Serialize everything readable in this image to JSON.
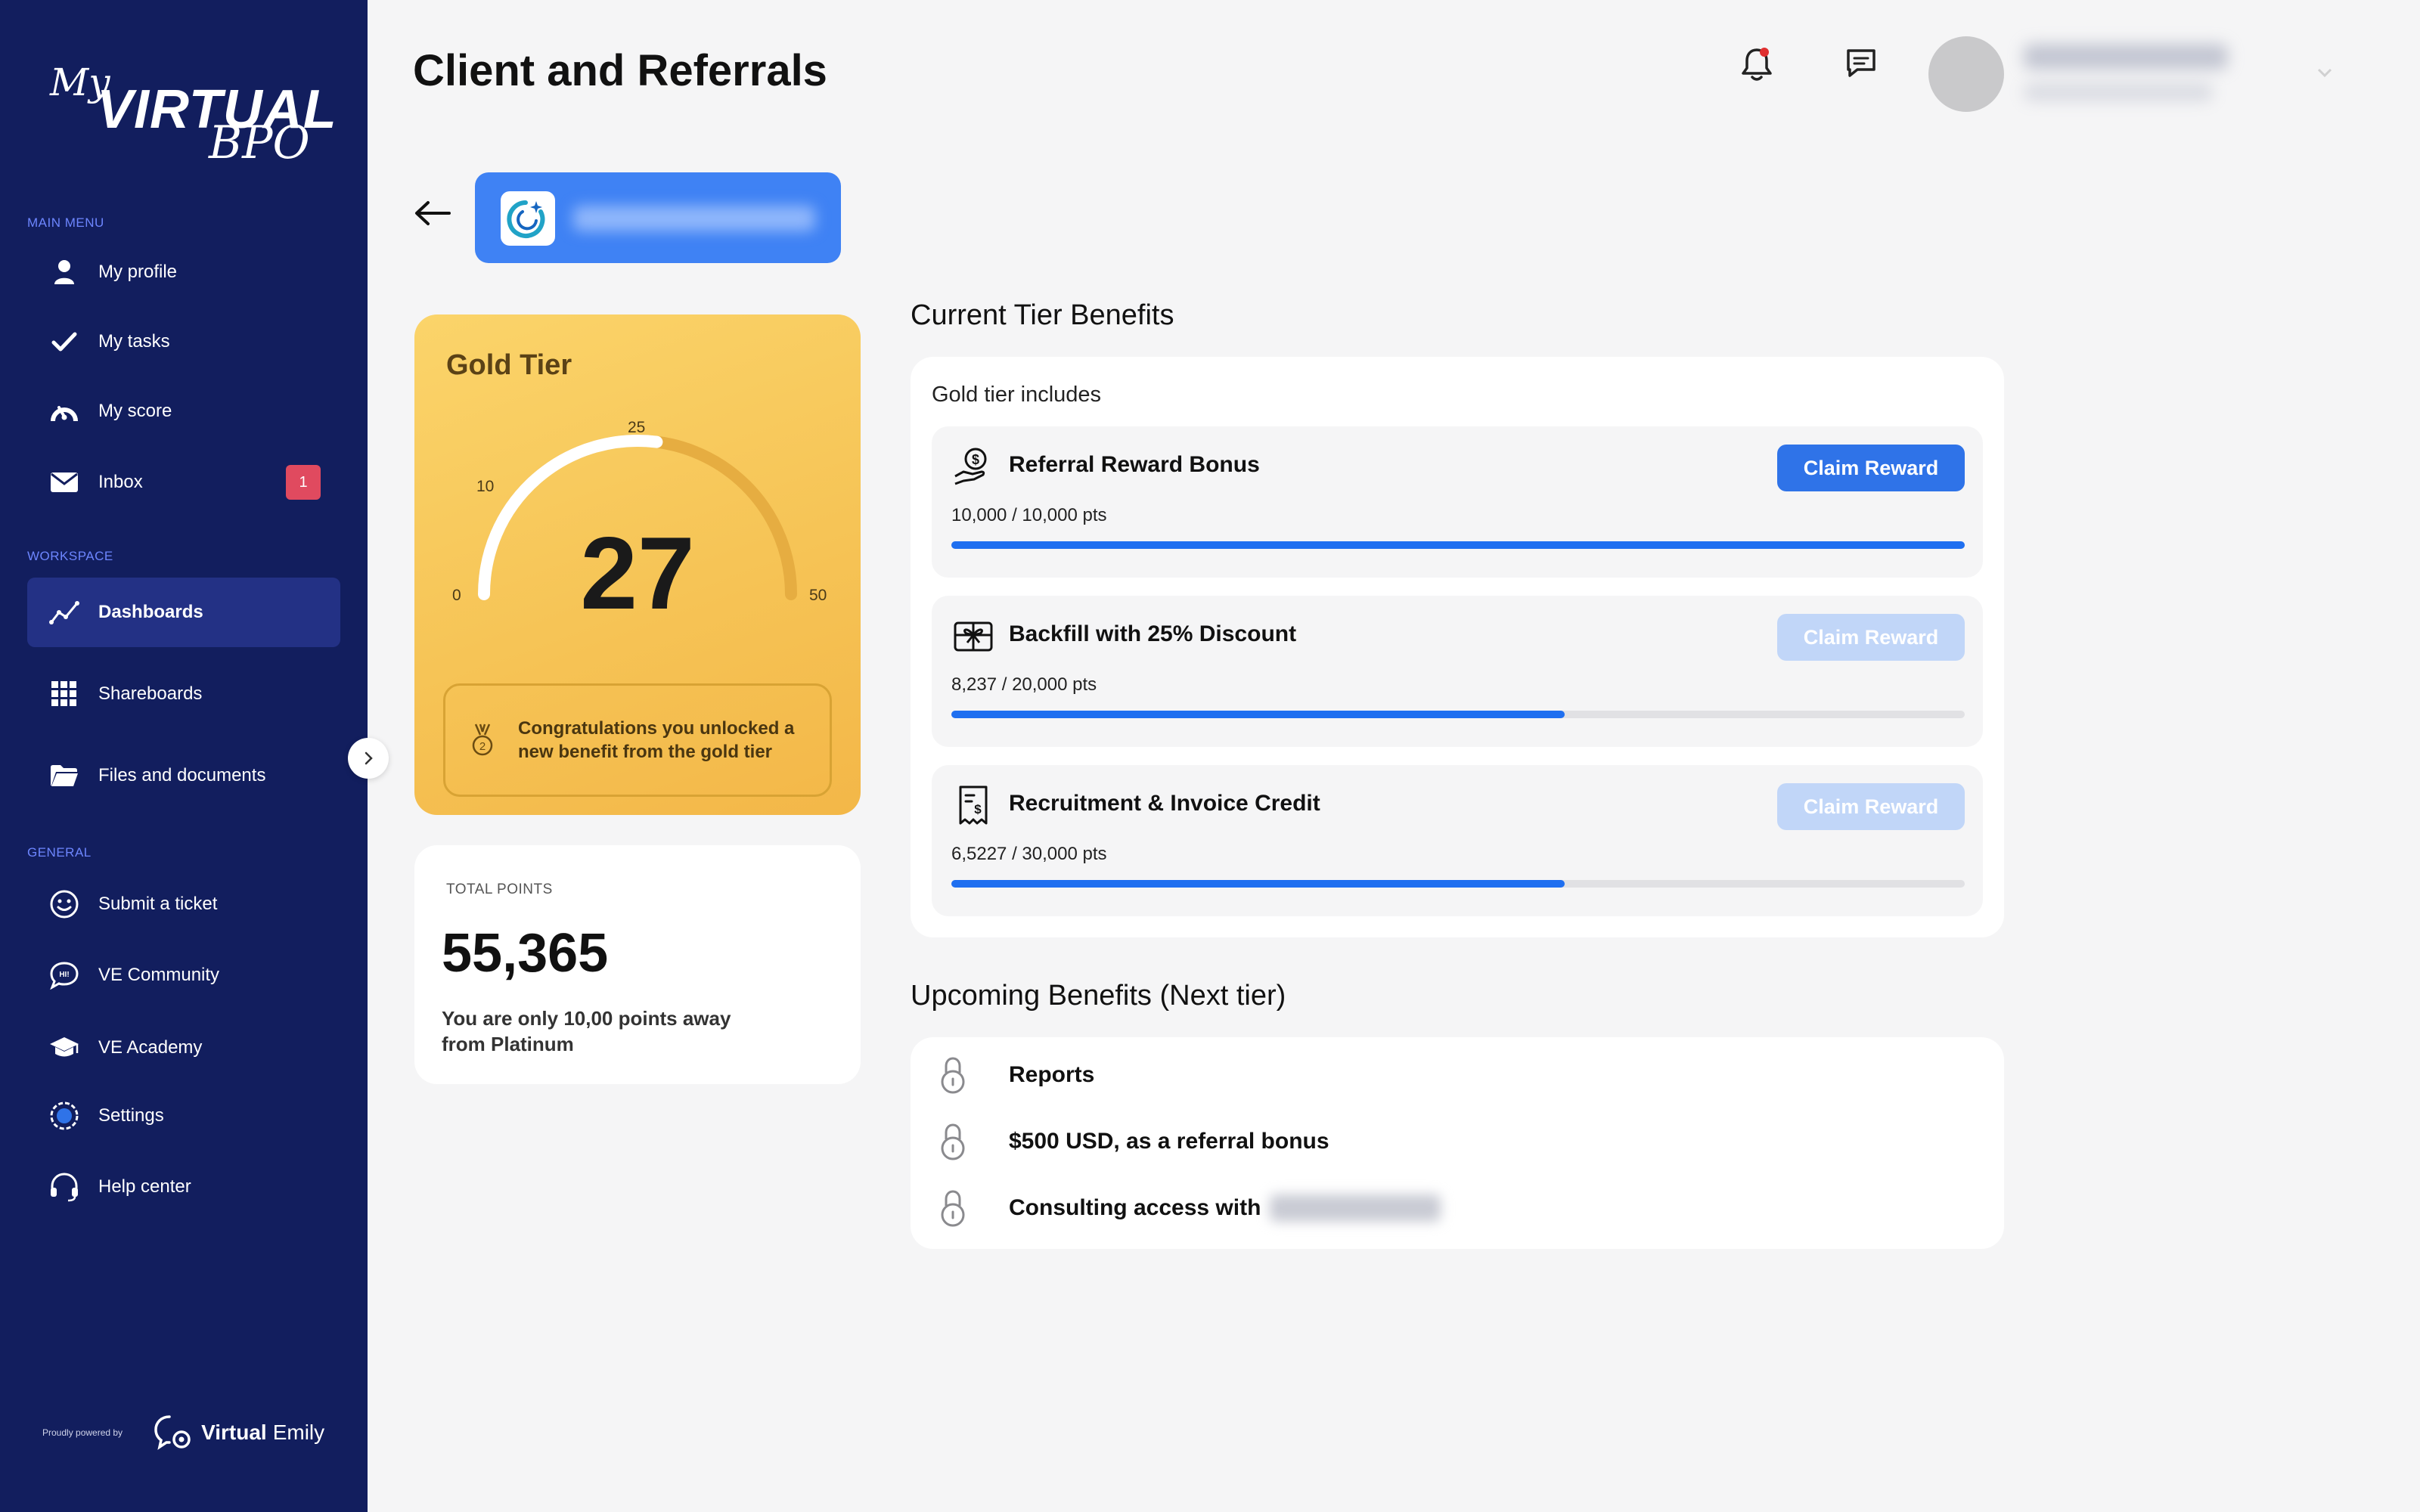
{
  "app": {
    "logo": {
      "my": "My",
      "virtual": "VIRTUAL",
      "bpo": "BPO"
    }
  },
  "sidebar": {
    "main_menu_label": "MAIN MENU",
    "main_menu": [
      {
        "label": "My profile",
        "icon": "user-icon"
      },
      {
        "label": "My tasks",
        "icon": "check-icon"
      },
      {
        "label": "My score",
        "icon": "gauge-icon"
      },
      {
        "label": "Inbox",
        "icon": "mail-icon",
        "badge": "1"
      }
    ],
    "workspace_label": "WORKSPACE",
    "workspace": [
      {
        "label": "Dashboards",
        "icon": "chart-line-icon",
        "active": true
      },
      {
        "label": "Shareboards",
        "icon": "grid-icon"
      },
      {
        "label": "Files and documents",
        "icon": "folder-icon"
      }
    ],
    "general_label": "GENERAL",
    "general": [
      {
        "label": "Submit a ticket",
        "icon": "smile-icon"
      },
      {
        "label": "VE Community",
        "icon": "chat-bubble-icon"
      },
      {
        "label": "VE Academy",
        "icon": "graduation-cap-icon"
      },
      {
        "label": "Settings",
        "icon": "settings-icon"
      },
      {
        "label": "Help center",
        "icon": "headset-icon"
      }
    ],
    "powered_by": "Proudly powered by",
    "powered_brand_bold": "Virtual",
    "powered_brand_light": "Emily"
  },
  "header": {
    "title": "Client and Referrals"
  },
  "tier_card": {
    "title": "Gold Tier",
    "gauge": {
      "value": 27,
      "min": 0,
      "max": 50,
      "ticks": [
        "0",
        "10",
        "25",
        "50"
      ],
      "display": "27"
    },
    "congrats": "Congratulations you unlocked a new benefit from the gold tier"
  },
  "points_card": {
    "label": "TOTAL POINTS",
    "value": "55,365",
    "note": "You are only 10,00 points away from Platinum"
  },
  "current_benefits": {
    "title": "Current Tier Benefits",
    "subtitle": "Gold tier includes",
    "items": [
      {
        "title": "Referral Reward Bonus",
        "points": "10,000 / 10,000 pts",
        "progress": 1.0,
        "button": "Claim Reward",
        "enabled": true,
        "icon": "money-hand-icon"
      },
      {
        "title": "Backfill with 25% Discount",
        "points": "8,237 / 20,000 pts",
        "progress": 0.605,
        "button": "Claim Reward",
        "enabled": false,
        "icon": "gift-icon"
      },
      {
        "title": "Recruitment & Invoice Credit",
        "points": "6,5227 / 30,000 pts",
        "progress": 0.605,
        "button": "Claim Reward",
        "enabled": false,
        "icon": "receipt-dollar-icon"
      }
    ]
  },
  "upcoming_benefits": {
    "title": "Upcoming Benefits (Next tier)",
    "items": [
      {
        "label": "Reports"
      },
      {
        "label": "$500 USD, as a referral bonus"
      },
      {
        "label": "Consulting access with"
      }
    ]
  },
  "colors": {
    "sidebar_bg": "#121e5e",
    "sidebar_active": "#233185",
    "accent_blue": "#2f73e8",
    "progress_blue": "#1f6ff0",
    "gold": "#f6c456",
    "badge_red": "#e04a5f"
  }
}
